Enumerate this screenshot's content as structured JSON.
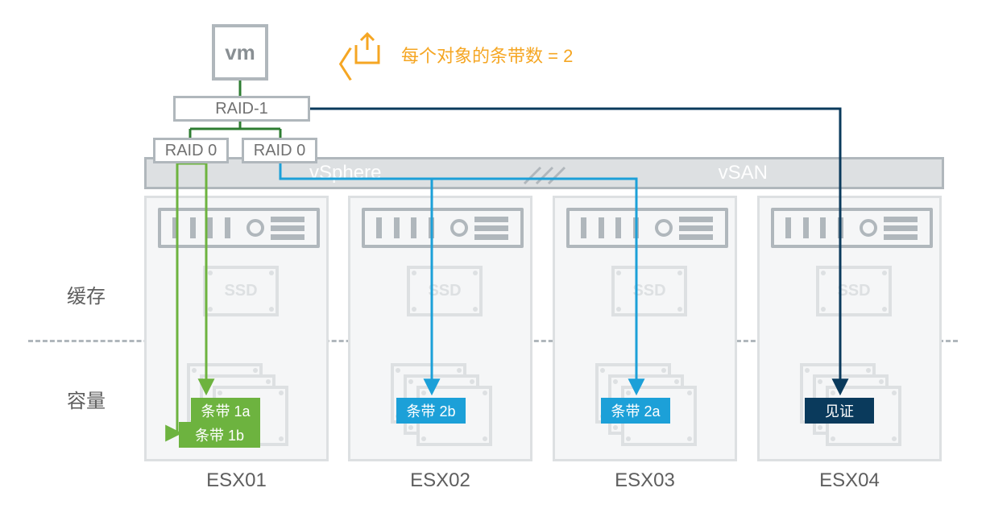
{
  "vm_label": "vm",
  "annotation": {
    "bracket": "〈",
    "text": "每个对象的条带数 = 2"
  },
  "raid": {
    "raid1": "RAID-1",
    "raid0a": "RAID 0",
    "raid0b": "RAID 0"
  },
  "cluster_bar": {
    "left": "vSphere",
    "right": "vSAN"
  },
  "side_labels": {
    "cache": "缓存",
    "capacity": "容量"
  },
  "ssd_label": "SSD",
  "hosts": [
    {
      "name": "ESX01"
    },
    {
      "name": "ESX02"
    },
    {
      "name": "ESX03"
    },
    {
      "name": "ESX04"
    }
  ],
  "badges": {
    "stripe1a": "条带 1a",
    "stripe1b": "条带 1b",
    "stripe2b": "条带 2b",
    "stripe2a": "条带 2a",
    "witness": "见证"
  },
  "colors": {
    "orange": "#F5A623",
    "green": "#6DB33F",
    "blue": "#1CA0D8",
    "navy": "#0A3A5C",
    "grey": "#B0B7BC"
  },
  "diagram_semantics": {
    "policy": "Number of disk stripes per object = 2",
    "topology": "RAID-1 mirror of two RAID-0 stripe sets across 4 ESXi hosts with a witness component",
    "components": [
      {
        "host": "ESX01",
        "items": [
          "Stripe 1a",
          "Stripe 1b"
        ],
        "via": "RAID 0 (left)"
      },
      {
        "host": "ESX02",
        "items": [
          "Stripe 2b"
        ],
        "via": "RAID 0 (right)"
      },
      {
        "host": "ESX03",
        "items": [
          "Stripe 2a"
        ],
        "via": "RAID 0 (right)"
      },
      {
        "host": "ESX04",
        "items": [
          "Witness"
        ],
        "via": "RAID-1"
      }
    ]
  }
}
